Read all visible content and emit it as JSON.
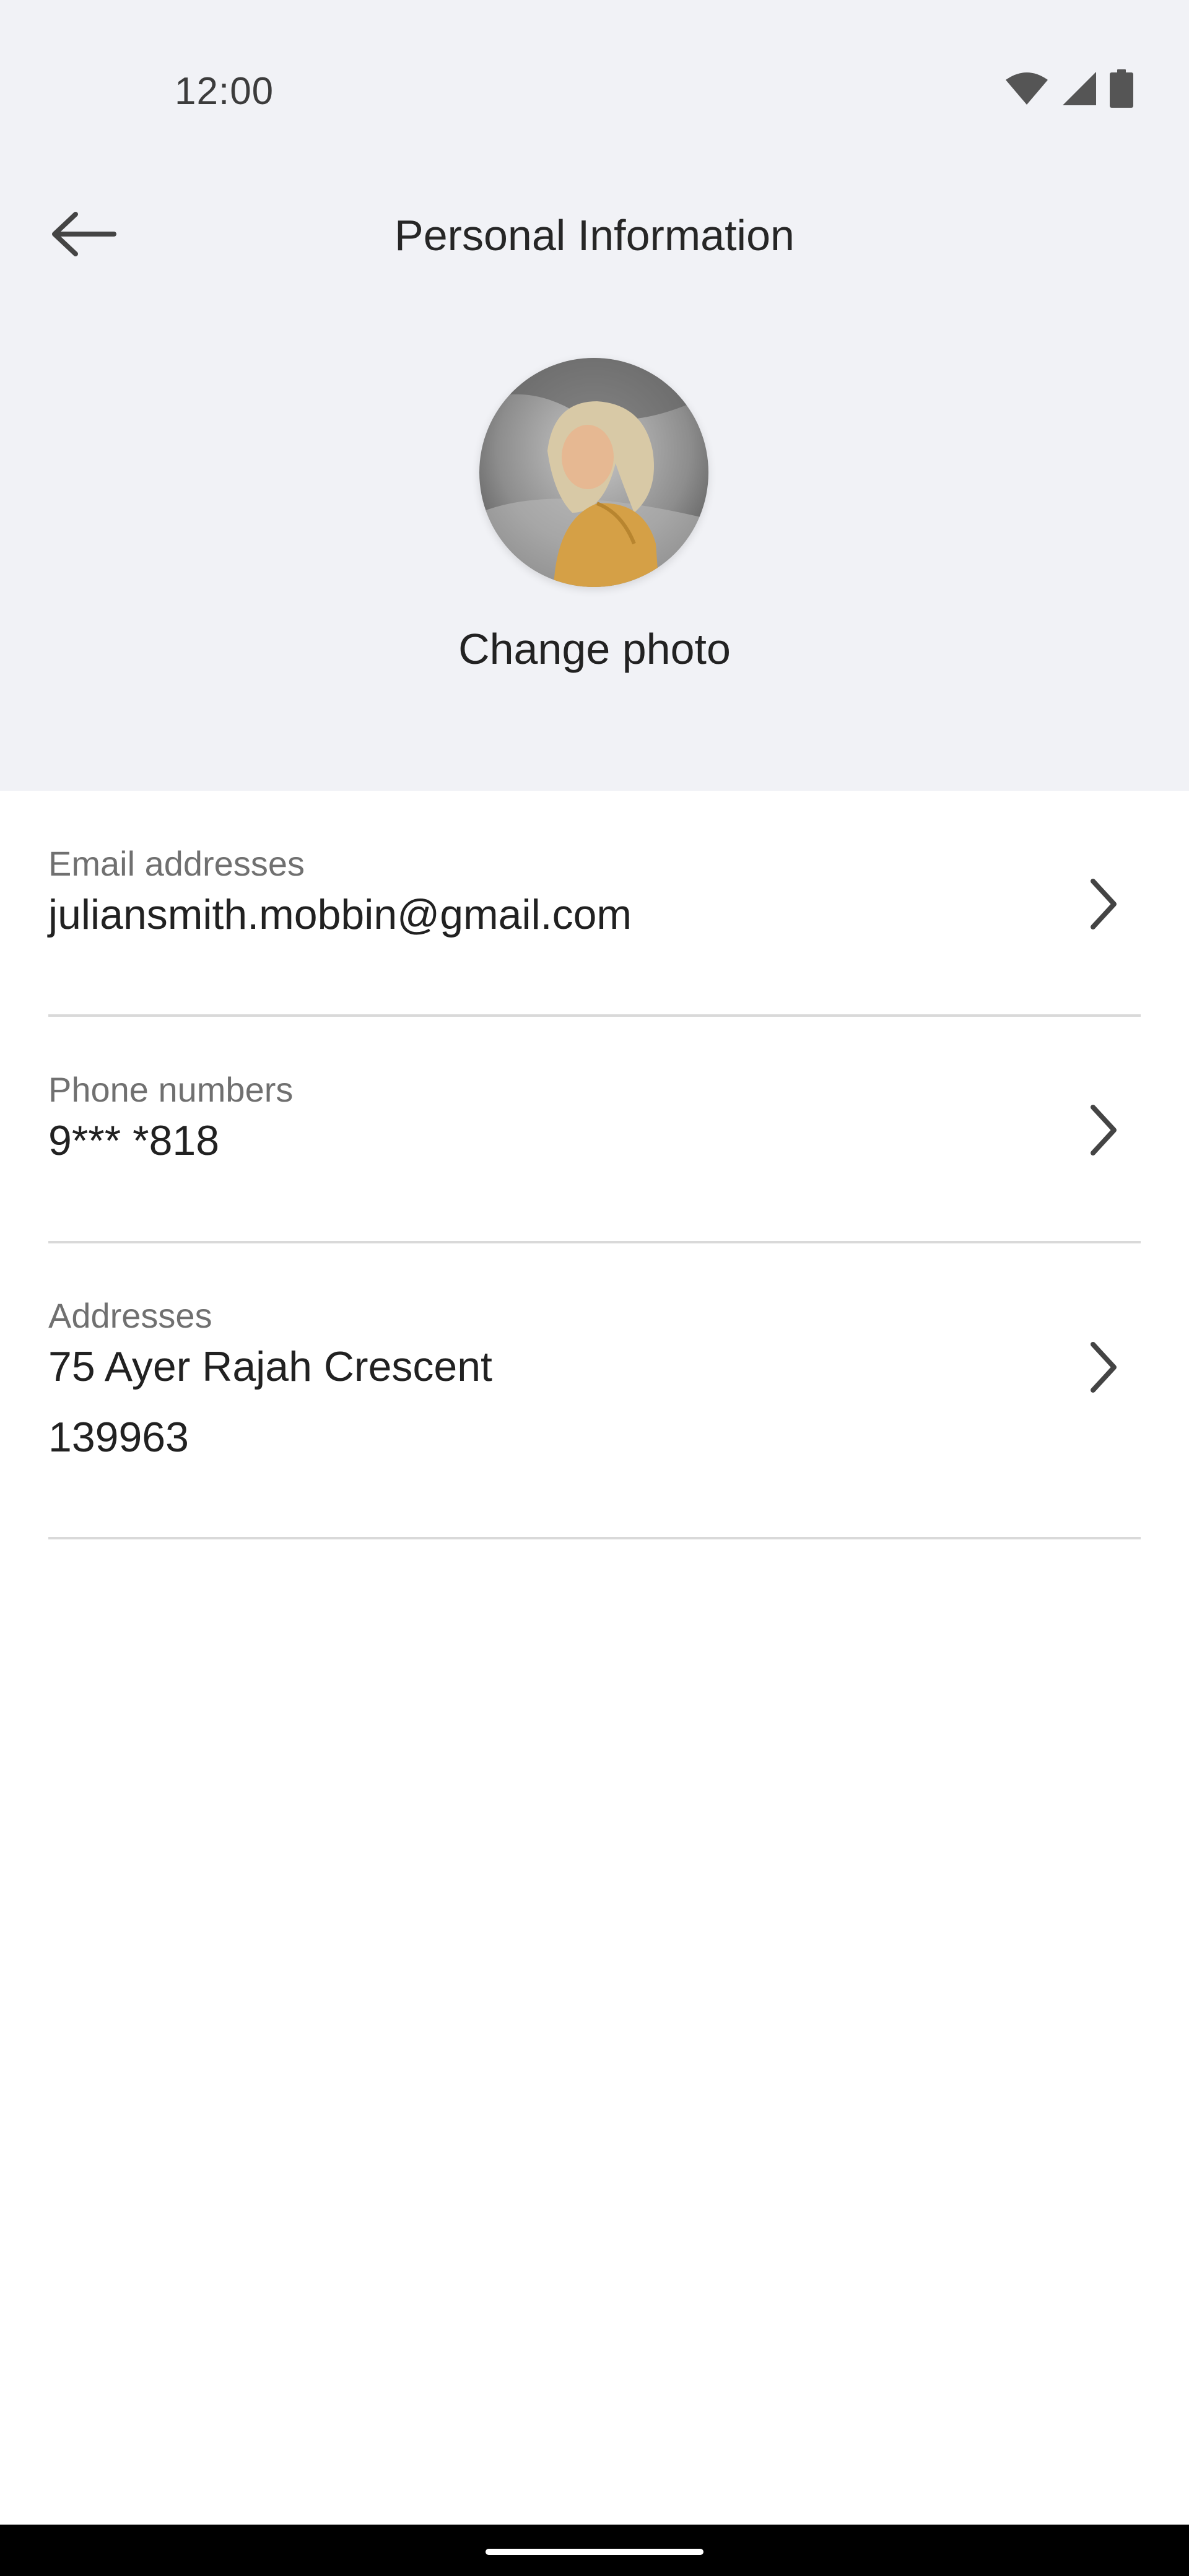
{
  "status_bar": {
    "time": "12:00",
    "icons": [
      "wifi-icon",
      "cellular-signal-icon",
      "battery-icon"
    ]
  },
  "header": {
    "back_icon": "arrow-left-icon",
    "title": "Personal Information"
  },
  "profile": {
    "change_photo_label": "Change photo"
  },
  "rows": [
    {
      "label": "Email addresses",
      "value": "juliansmith.mobbin@gmail.com",
      "icon": "chevron-right-icon"
    },
    {
      "label": "Phone numbers",
      "value": "9*** *818",
      "icon": "chevron-right-icon"
    },
    {
      "label": "Addresses",
      "value_lines": [
        "75 Ayer Rajah Crescent",
        "139963"
      ],
      "icon": "chevron-right-icon"
    }
  ],
  "colors": {
    "header_bg": "#f1f2f6",
    "divider": "#d9d9d9",
    "label_text": "#707070",
    "value_text": "#212121"
  }
}
